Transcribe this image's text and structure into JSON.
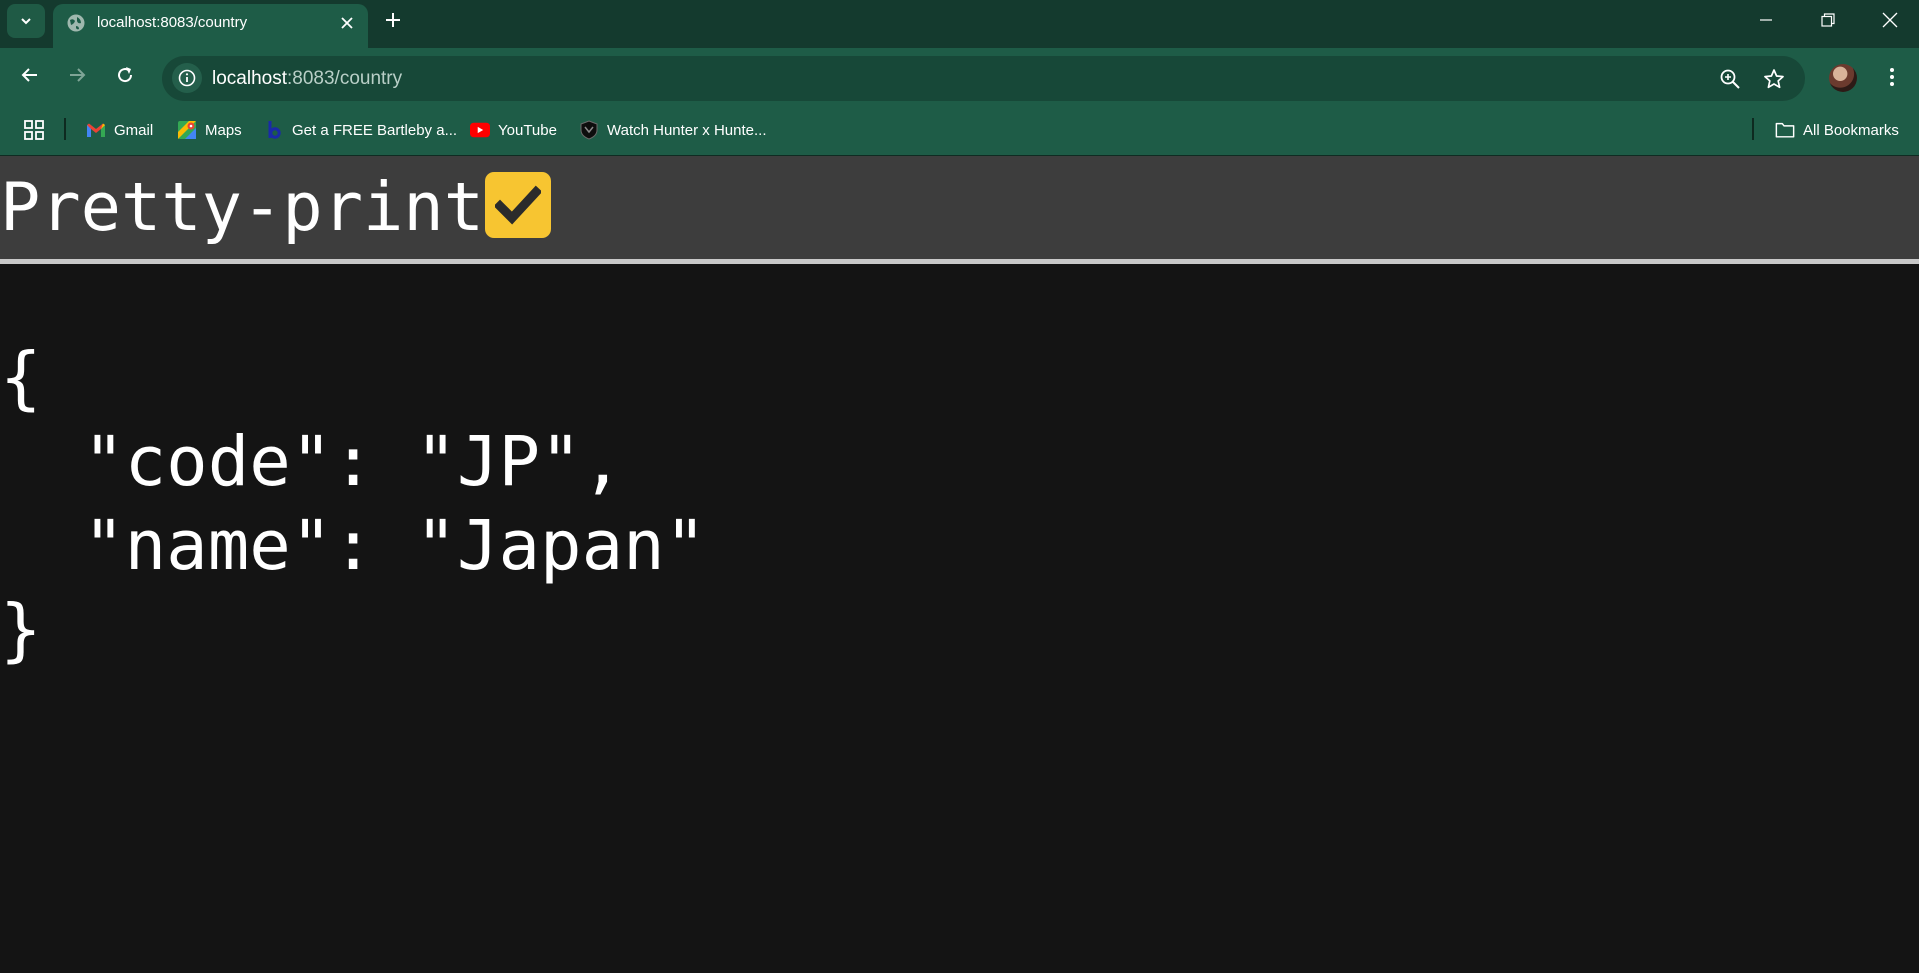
{
  "tab": {
    "title": "localhost:8083/country",
    "favicon": "globe-icon"
  },
  "toolbar": {
    "url_host": "localhost",
    "url_rest": ":8083/country"
  },
  "bookmarks": [
    {
      "label": "Gmail",
      "icon": "gmail-icon"
    },
    {
      "label": "Maps",
      "icon": "maps-icon"
    },
    {
      "label": "Get a FREE Bartleby a...",
      "icon": "bartleby-icon"
    },
    {
      "label": "YouTube",
      "icon": "youtube-icon"
    },
    {
      "label": "Watch Hunter x Hunte...",
      "icon": "shield-icon"
    }
  ],
  "all_bookmarks_label": "All Bookmarks",
  "page": {
    "title": "Pretty-print",
    "pretty_print_checked": true,
    "json": {
      "open_brace": "{",
      "line1": "  \"code\": \"JP\",",
      "line2": "  \"name\": \"Japan\"",
      "close_brace": "}"
    }
  },
  "colors": {
    "tabstrip": "#143a2e",
    "toolbar": "#1e5c47",
    "checkbox": "#f7c531",
    "page_header": "#3d3d3d",
    "page_bg": "#141414"
  }
}
